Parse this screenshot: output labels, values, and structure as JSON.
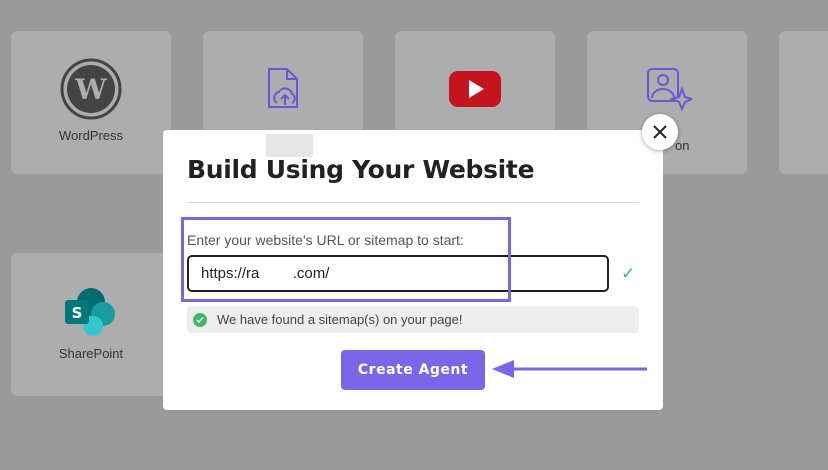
{
  "background_cards": [
    {
      "label": "WordPress",
      "icon": "wordpress-icon"
    },
    {
      "label": "",
      "icon": "file-upload-icon"
    },
    {
      "label": "",
      "icon": "youtube-icon"
    },
    {
      "label": "on",
      "icon": "image-sparkle-icon"
    },
    {
      "label": "",
      "icon": ""
    },
    {
      "label": "SharePoint",
      "icon": "sharepoint-icon"
    }
  ],
  "modal": {
    "title": "Build Using Your Website",
    "url_label": "Enter your website's URL or sitemap to start:",
    "url_value": "https://ra        .com/",
    "status_message": "We have found a sitemap(s) on your page!",
    "create_button": "Create Agent",
    "close_icon": "close-icon"
  },
  "colors": {
    "accent": "#7b66e9",
    "success": "#3cba65",
    "overlay": "#9a9a9a"
  }
}
